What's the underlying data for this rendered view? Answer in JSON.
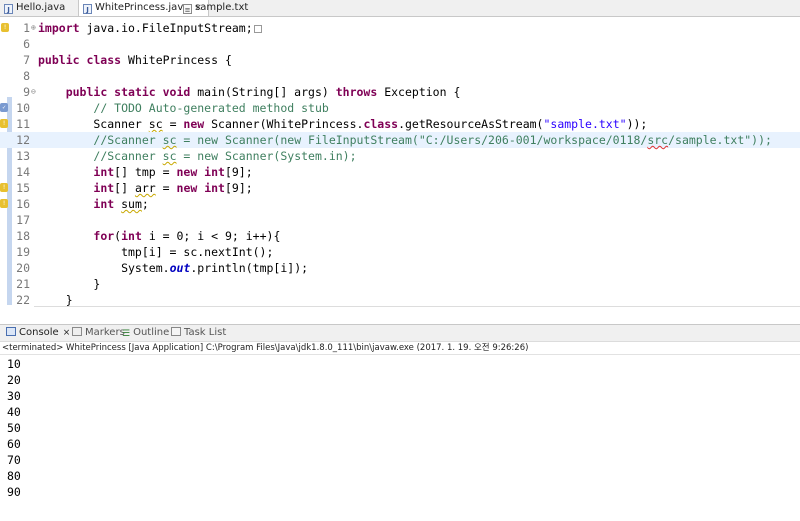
{
  "editor_tabs": [
    {
      "label": "Hello.java",
      "active": false
    },
    {
      "label": "WhitePrincess.java",
      "active": true,
      "close": "⨯"
    },
    {
      "label": "sample.txt",
      "active": false
    }
  ],
  "code_lines": [
    {
      "num": "1",
      "html": "<span class=\"kw\">import</span> java.io.FileInputStream;<span class=\"collapsed\"></span>"
    },
    {
      "num": "6",
      "html": ""
    },
    {
      "num": "7",
      "html": "<span class=\"kw\">public class</span> WhitePrincess {"
    },
    {
      "num": "8",
      "html": ""
    },
    {
      "num": "9",
      "html": "    <span class=\"kw\">public static void</span> main(String[] args) <span class=\"kw\">throws</span> Exception {"
    },
    {
      "num": "10",
      "html": "        <span class=\"cm\">// TODO Auto-generated method stub</span>"
    },
    {
      "num": "11",
      "html": "        Scanner <span class=\"unused\">sc</span> = <span class=\"kw\">new</span> Scanner(WhitePrincess.<span class=\"kw\">class</span>.getResourceAsStream(<span class=\"str\">\"sample.txt\"</span>));"
    },
    {
      "num": "12",
      "html": "        <span class=\"cm\">//Scanner <span class=\"unused\">sc</span> = new Scanner(new FileInputStream(\"C:/Users/206-001/workspace/0118/<span class=\"spell\">src</span>/sample.txt\"));</span>"
    },
    {
      "num": "13",
      "html": "        <span class=\"cm\">//Scanner <span class=\"unused\">sc</span> = new Scanner(System.in);</span>"
    },
    {
      "num": "14",
      "html": "        <span class=\"kw\">int</span>[] tmp = <span class=\"kw\">new int</span>[9];"
    },
    {
      "num": "15",
      "html": "        <span class=\"kw\">int</span>[] <span class=\"unused\">arr</span> = <span class=\"kw\">new int</span>[9];"
    },
    {
      "num": "16",
      "html": "        <span class=\"kw\">int</span> <span class=\"unused\">sum</span>;"
    },
    {
      "num": "17",
      "html": ""
    },
    {
      "num": "18",
      "html": "        <span class=\"kw\">for</span>(<span class=\"kw\">int</span> i = 0; i &lt; 9; i++){"
    },
    {
      "num": "19",
      "html": "            tmp[i] = sc.nextInt();"
    },
    {
      "num": "20",
      "html": "            System.<span class=\"sfld\">out</span>.println(tmp[i]);"
    },
    {
      "num": "21",
      "html": "        }"
    },
    {
      "num": "22",
      "html": "    }"
    }
  ],
  "panel_tabs": [
    {
      "label": "Console",
      "close": "⨯",
      "icon": "console-icon"
    },
    {
      "label": "Markers",
      "icon": "markers-icon"
    },
    {
      "label": "Outline",
      "icon": "outline-icon"
    },
    {
      "label": "Task List",
      "icon": "task-list-icon"
    }
  ],
  "console": {
    "status": "<terminated> WhitePrincess [Java Application] C:\\Program Files\\Java\\jdk1.8.0_111\\bin\\javaw.exe (2017. 1. 19. 오전 9:26:26)",
    "output": [
      "10",
      "20",
      "30",
      "40",
      "50",
      "60",
      "70",
      "80",
      "90"
    ]
  }
}
